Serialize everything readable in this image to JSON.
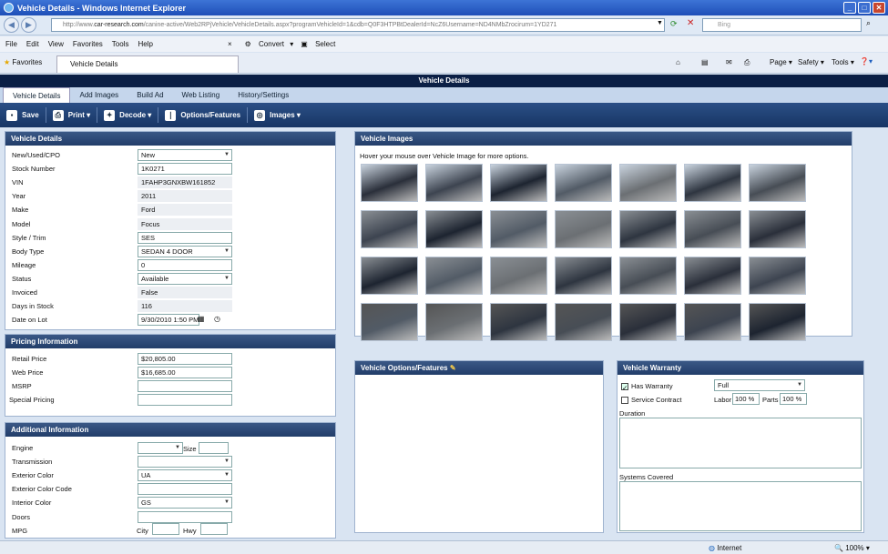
{
  "window": {
    "title": "Vehicle Details - Windows Internet Explorer"
  },
  "address": {
    "url_prefix": "http://www.",
    "url_host": "car-research.com",
    "url_rest": "/canine-active/Web2RPjVehicle/VehicleDetails.aspx?programVehicleId=1&cdb=Q0F3HTPBtDealerId=NcZ6Username=ND4NMbZrocirum=1YD271",
    "search_placeholder": "Bing"
  },
  "menu": [
    "File",
    "Edit",
    "View",
    "Favorites",
    "Tools",
    "Help"
  ],
  "menu_tools": {
    "convert": "Convert",
    "select": "Select"
  },
  "favbar": {
    "favorites": "Favorites",
    "tab": "Vehicle Details",
    "page": "Page",
    "safety": "Safety",
    "tools": "Tools"
  },
  "app": {
    "title": "Vehicle Details"
  },
  "tabs": [
    "Vehicle Details",
    "Add Images",
    "Build Ad",
    "Web Listing",
    "History/Settings"
  ],
  "toolbar": {
    "save": "Save",
    "print": "Print",
    "decode": "Decode",
    "options": "Options/Features",
    "images": "Images"
  },
  "vehicle_details": {
    "header": "Vehicle Details",
    "rows": [
      {
        "label": "New/Used/CPO",
        "value": "New"
      },
      {
        "label": "Stock Number",
        "value": "1K0271"
      },
      {
        "label": "VIN",
        "value": "1FAHP3GNXBW161852"
      },
      {
        "label": "Year",
        "value": "2011"
      },
      {
        "label": "Make",
        "value": "Ford"
      },
      {
        "label": "Model",
        "value": "Focus"
      },
      {
        "label": "Style / Trim",
        "value": "SES"
      },
      {
        "label": "Body Type",
        "value": "SEDAN 4 DOOR"
      },
      {
        "label": "Mileage",
        "value": "0"
      },
      {
        "label": "Status",
        "value": "Available"
      },
      {
        "label": "Invoiced",
        "value": "False"
      },
      {
        "label": "Days in Stock",
        "value": "116"
      },
      {
        "label": "Date on Lot",
        "value": "9/30/2010 1:50 PM"
      }
    ]
  },
  "pricing": {
    "header": "Pricing Information",
    "rows": [
      {
        "label": "Retail Price",
        "value": "$20,805.00"
      },
      {
        "label": "Web Price",
        "value": "$16,685.00"
      },
      {
        "label": "MSRP",
        "value": ""
      },
      {
        "label": "Special Pricing",
        "value": ""
      }
    ]
  },
  "additional": {
    "header": "Additional Information",
    "rows": [
      {
        "label": "Engine",
        "value": ""
      },
      {
        "label": "Transmission",
        "value": ""
      },
      {
        "label": "Exterior Color",
        "value": "UA"
      },
      {
        "label": "Exterior Color Code",
        "value": ""
      },
      {
        "label": "Interior Color",
        "value": "GS"
      },
      {
        "label": "Doors",
        "value": ""
      },
      {
        "label": "MPG",
        "value": ""
      }
    ],
    "size_label": "Size",
    "city_label": "City",
    "hwy_label": "Hwy"
  },
  "images": {
    "header": "Vehicle Images",
    "hint": "Hover your mouse over Vehicle Image for more options."
  },
  "options": {
    "header": "Vehicle Options/Features"
  },
  "warranty": {
    "header": "Vehicle Warranty",
    "has_warranty": "Has Warranty",
    "service_contract": "Service Contract",
    "type": "Full",
    "labor_label": "Labor",
    "labor": "100 %",
    "parts_label": "Parts",
    "parts": "100 %",
    "duration": "Duration",
    "systems": "Systems Covered"
  },
  "status": {
    "zone": "Internet",
    "zoom": "100%"
  }
}
